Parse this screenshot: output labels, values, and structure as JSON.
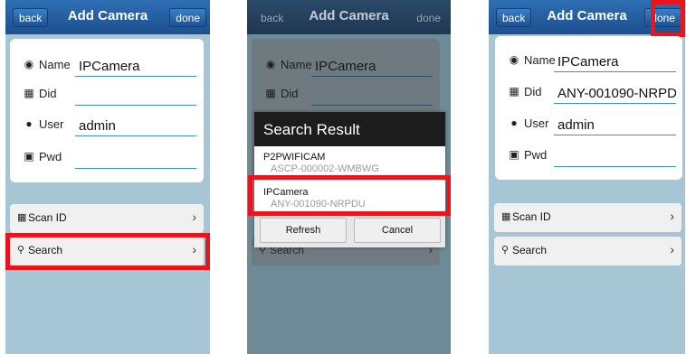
{
  "header": {
    "back_label": "back",
    "title": "Add Camera",
    "done_label": "done"
  },
  "form": {
    "name_label": "Name",
    "did_label": "Did",
    "user_label": "User",
    "pwd_label": "Pwd",
    "name_value": "IPCamera",
    "user_value": "admin",
    "did_value_after_select": "ANY-001090-NRPD"
  },
  "menu": {
    "scan_label": "Scan ID",
    "search_label": "Search"
  },
  "dialog": {
    "title": "Search Result",
    "results": [
      {
        "name": "P2PWIFICAM",
        "uid": "ASCP-000002-WMBWG"
      },
      {
        "name": "IPCamera",
        "uid": "ANY-001090-NRPDU"
      }
    ],
    "refresh_label": "Refresh",
    "cancel_label": "Cancel"
  },
  "icons": {
    "name": "person-badge-icon",
    "did": "grid-icon",
    "user": "user-icon",
    "pwd": "lock-icon",
    "scan": "qr-code-icon",
    "search": "search-icon",
    "chevron": "chevron-right-icon"
  },
  "colors": {
    "highlight": "#e8161c",
    "nav_bar": "#1d4f8d",
    "background": "#a6c6d6"
  }
}
